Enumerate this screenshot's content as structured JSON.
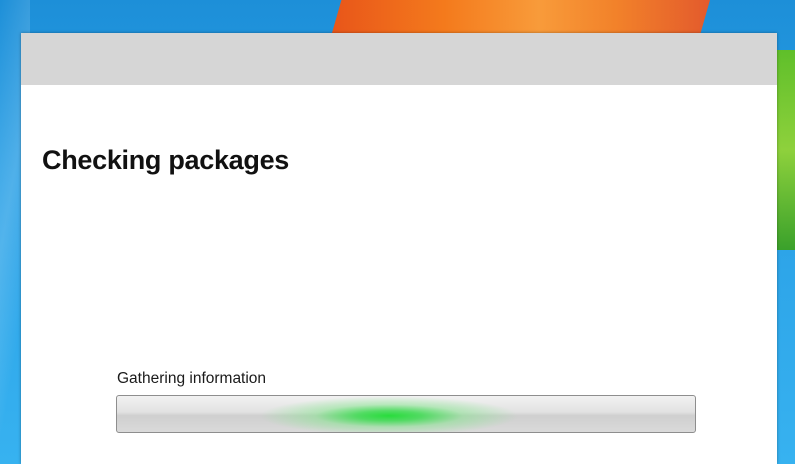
{
  "dialog": {
    "heading": "Checking packages",
    "status_text": "Gathering information"
  },
  "progress": {
    "mode": "indeterminate-marquee",
    "marquee_center_fraction": 0.47,
    "color": "#28dc3c"
  },
  "colors": {
    "title_strip": "#d6d6d6",
    "window_bg": "#ffffff",
    "desktop_blue": "#2aa0e6",
    "desktop_orange": "#f47a1c"
  }
}
